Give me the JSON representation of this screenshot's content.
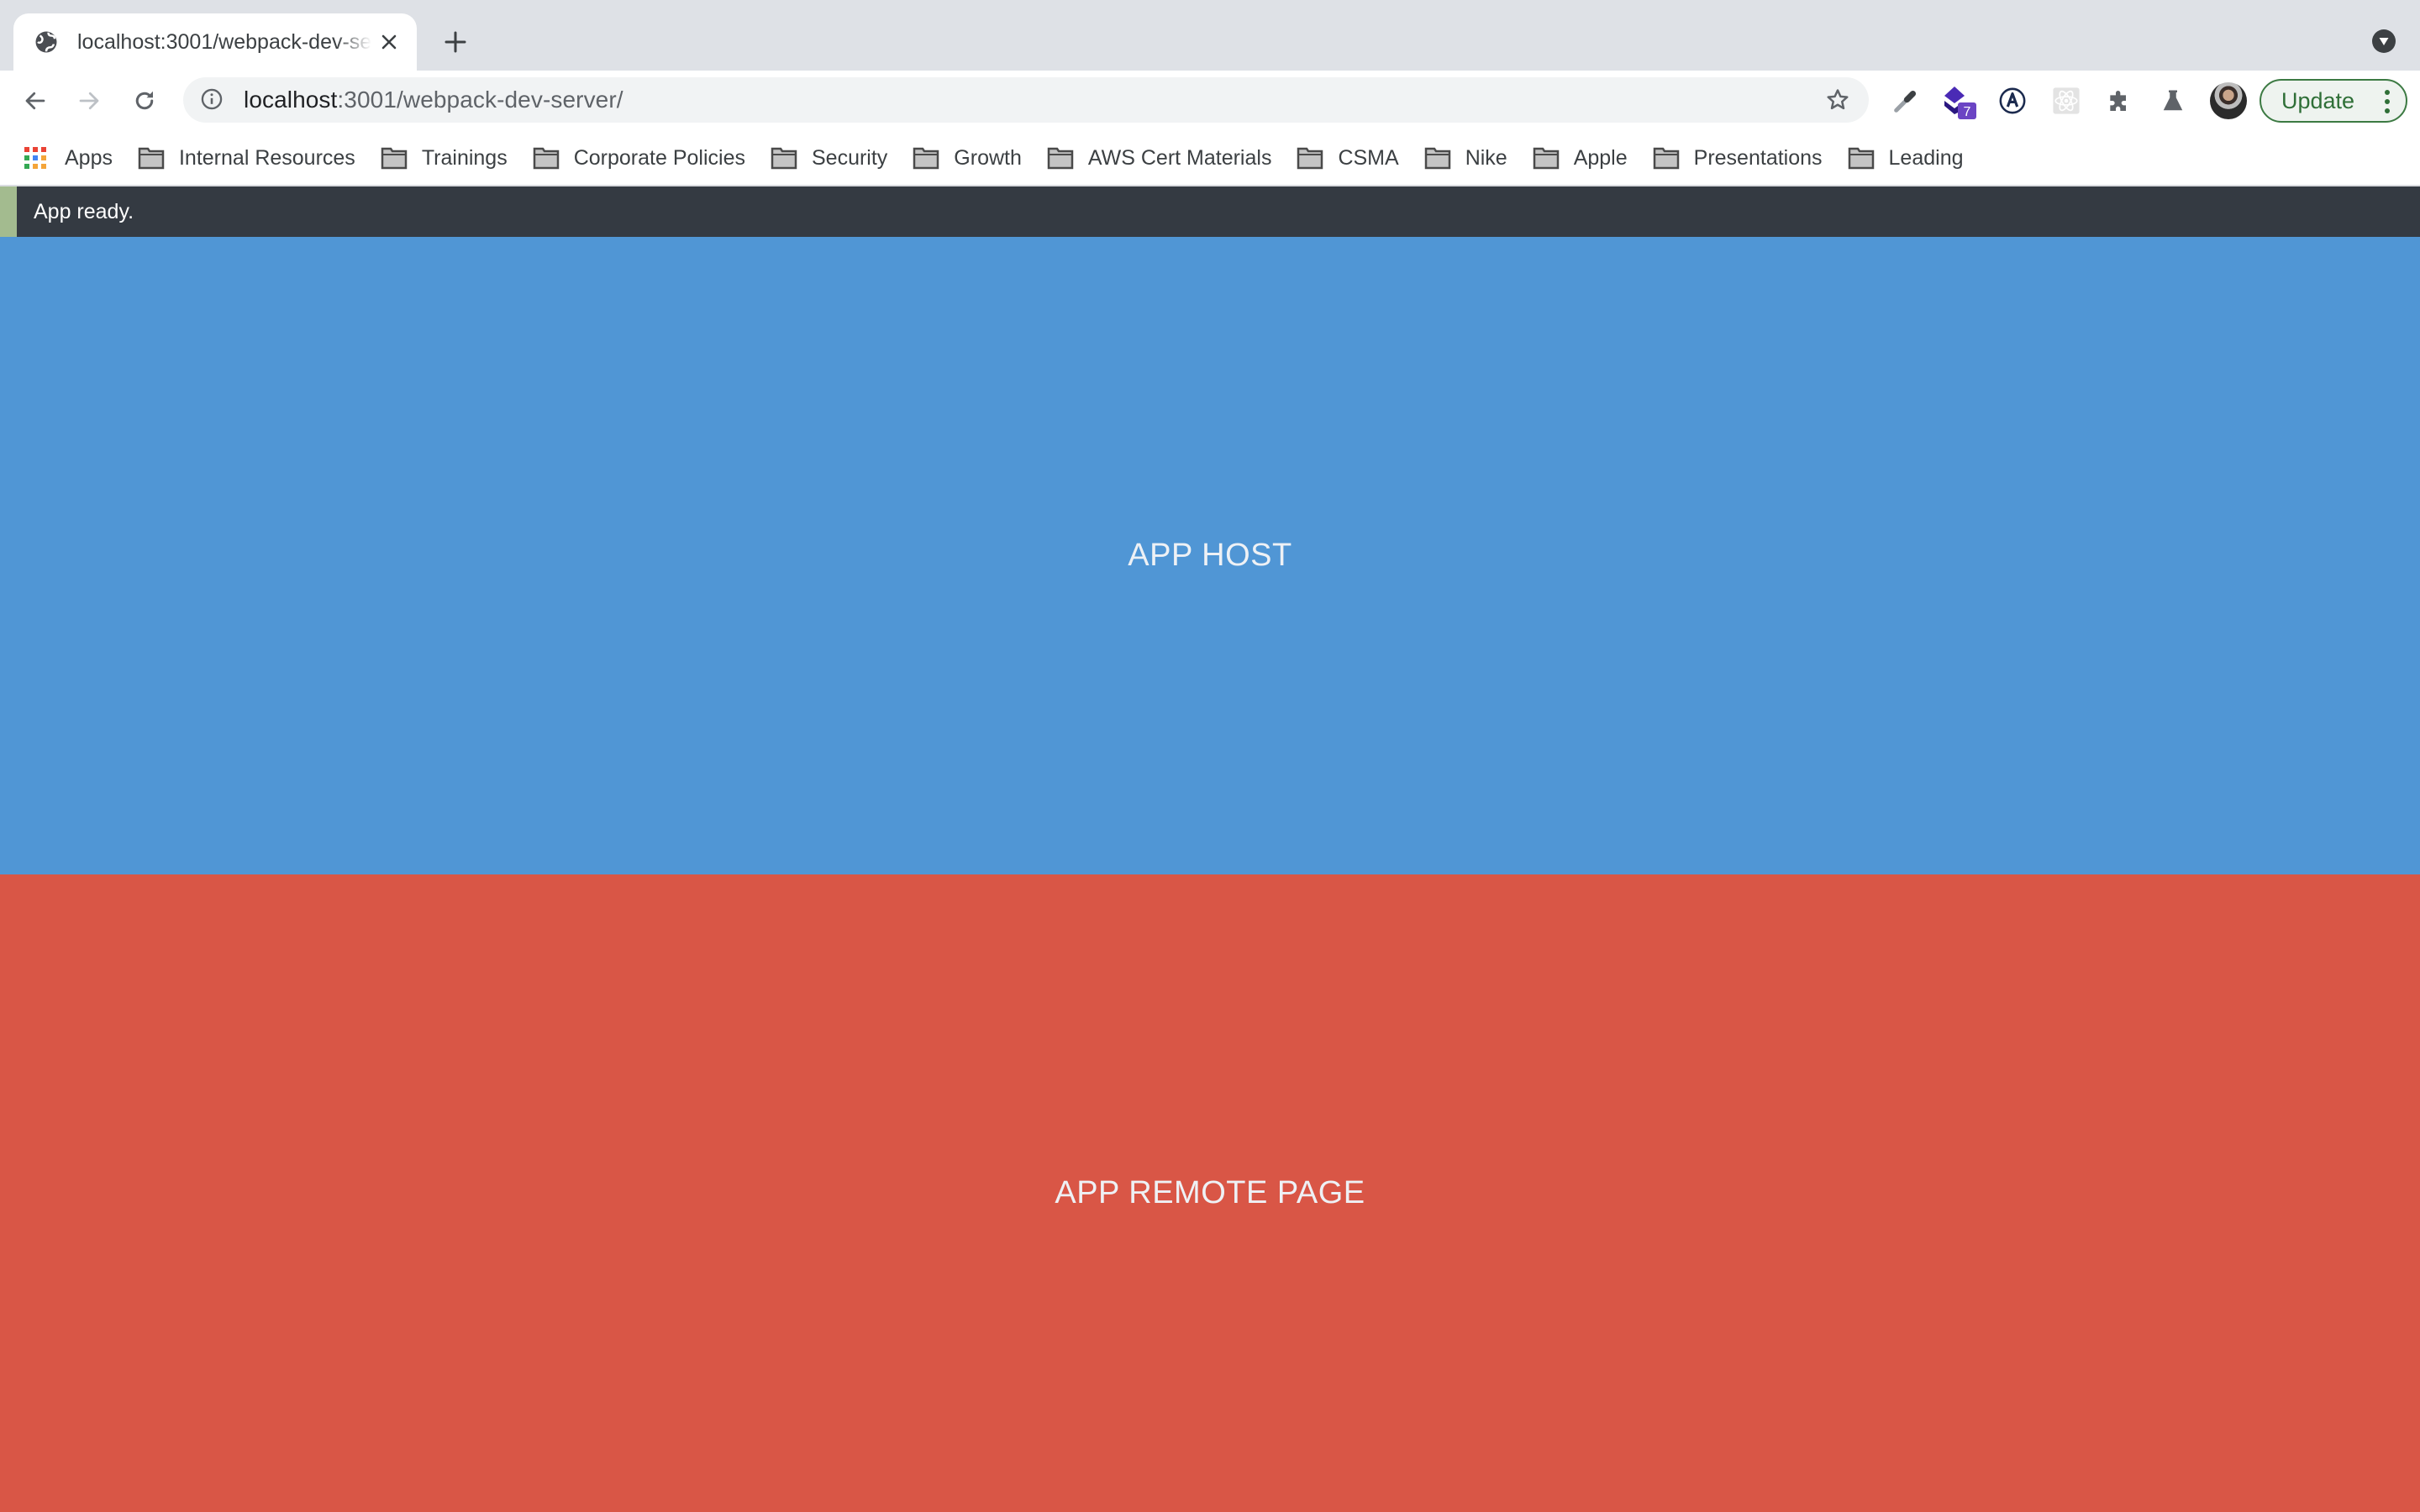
{
  "browser": {
    "tab": {
      "title": "localhost:3001/webpack-dev-server/",
      "favicon": "globe-icon",
      "close_icon": "close-icon"
    },
    "new_tab_icon": "plus-icon",
    "tab_search_icon": "chevron-down-circle-icon",
    "toolbar": {
      "back_icon": "arrow-left-icon",
      "forward_icon": "arrow-right-icon",
      "reload_icon": "reload-icon",
      "omnibox": {
        "security_icon": "info-icon",
        "url_host": "localhost",
        "url_rest": ":3001/webpack-dev-server/",
        "bookmark_icon": "star-icon"
      },
      "extensions": [
        {
          "name": "eyedropper-icon"
        },
        {
          "name": "stack-extension-icon",
          "badge": "7"
        },
        {
          "name": "circle-a-icon"
        },
        {
          "name": "react-devtools-icon"
        },
        {
          "name": "puzzle-icon"
        },
        {
          "name": "flask-icon"
        }
      ],
      "profile_icon": "avatar",
      "update_button": {
        "label": "Update",
        "menu_icon": "kebab-menu-icon"
      }
    },
    "bookmarks": [
      {
        "label": "Apps",
        "icon": "apps-grid-icon"
      },
      {
        "label": "Internal Resources",
        "icon": "folder-icon"
      },
      {
        "label": "Trainings",
        "icon": "folder-icon"
      },
      {
        "label": "Corporate Policies",
        "icon": "folder-icon"
      },
      {
        "label": "Security",
        "icon": "folder-icon"
      },
      {
        "label": "Growth",
        "icon": "folder-icon"
      },
      {
        "label": "AWS Cert Materials",
        "icon": "folder-icon"
      },
      {
        "label": "CSMA",
        "icon": "folder-icon"
      },
      {
        "label": "Nike",
        "icon": "folder-icon"
      },
      {
        "label": "Apple",
        "icon": "folder-icon"
      },
      {
        "label": "Presentations",
        "icon": "folder-icon"
      },
      {
        "label": "Leading",
        "icon": "folder-icon"
      }
    ]
  },
  "page": {
    "status_message": "App ready.",
    "host_panel": {
      "text": "APP HOST",
      "color": "#5096d5"
    },
    "remote_panel": {
      "text": "APP REMOTE PAGE",
      "color": "#d95646"
    },
    "status_bar_color": "#343a42",
    "status_accent_color": "#a3bb8f"
  }
}
